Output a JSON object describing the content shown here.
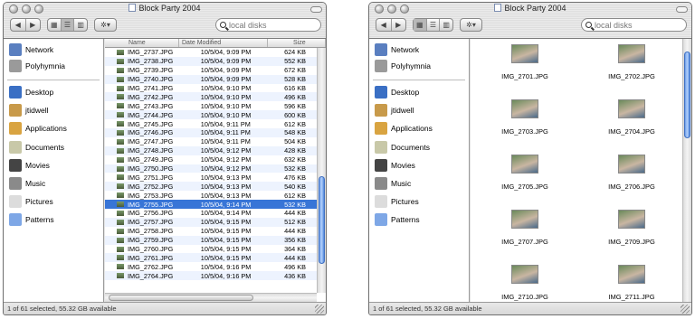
{
  "window_title": "Block Party 2004",
  "search_placeholder": "local disks",
  "toolbar": {
    "back": "◀",
    "forward": "▶",
    "icon_view": "▦",
    "list_view": "☰",
    "column_view": "▥",
    "action": "✲▾"
  },
  "sidebar": {
    "devices": [
      {
        "label": "Network",
        "icon": "network-icon",
        "color": "#5a7fc0"
      },
      {
        "label": "Polyhymnia",
        "icon": "hard-disk-icon",
        "color": "#9a9a9a"
      }
    ],
    "places": [
      {
        "label": "Desktop",
        "icon": "desktop-icon",
        "color": "#3a6fc4"
      },
      {
        "label": "jtidwell",
        "icon": "home-icon",
        "color": "#c89a4a"
      },
      {
        "label": "Applications",
        "icon": "applications-icon",
        "color": "#d9a441"
      },
      {
        "label": "Documents",
        "icon": "documents-icon",
        "color": "#c8c8a8"
      },
      {
        "label": "Movies",
        "icon": "movies-icon",
        "color": "#444444"
      },
      {
        "label": "Music",
        "icon": "music-icon",
        "color": "#8a8a8a"
      },
      {
        "label": "Pictures",
        "icon": "pictures-icon",
        "color": "#dcdcdc"
      },
      {
        "label": "Patterns",
        "icon": "folder-icon",
        "color": "#7ea7e6"
      }
    ]
  },
  "list_view": {
    "columns": [
      "Name",
      "Date Modified",
      "Size"
    ],
    "rows": [
      [
        "IMG_2737.JPG",
        "10/5/04, 9:09 PM",
        "624 KB"
      ],
      [
        "IMG_2738.JPG",
        "10/5/04, 9:09 PM",
        "552 KB"
      ],
      [
        "IMG_2739.JPG",
        "10/5/04, 9:09 PM",
        "672 KB"
      ],
      [
        "IMG_2740.JPG",
        "10/5/04, 9:09 PM",
        "528 KB"
      ],
      [
        "IMG_2741.JPG",
        "10/5/04, 9:10 PM",
        "616 KB"
      ],
      [
        "IMG_2742.JPG",
        "10/5/04, 9:10 PM",
        "496 KB"
      ],
      [
        "IMG_2743.JPG",
        "10/5/04, 9:10 PM",
        "596 KB"
      ],
      [
        "IMG_2744.JPG",
        "10/5/04, 9:10 PM",
        "600 KB"
      ],
      [
        "IMG_2745.JPG",
        "10/5/04, 9:11 PM",
        "612 KB"
      ],
      [
        "IMG_2746.JPG",
        "10/5/04, 9:11 PM",
        "548 KB"
      ],
      [
        "IMG_2747.JPG",
        "10/5/04, 9:11 PM",
        "504 KB"
      ],
      [
        "IMG_2748.JPG",
        "10/5/04, 9:12 PM",
        "428 KB"
      ],
      [
        "IMG_2749.JPG",
        "10/5/04, 9:12 PM",
        "632 KB"
      ],
      [
        "IMG_2750.JPG",
        "10/5/04, 9:12 PM",
        "532 KB"
      ],
      [
        "IMG_2751.JPG",
        "10/5/04, 9:13 PM",
        "476 KB"
      ],
      [
        "IMG_2752.JPG",
        "10/5/04, 9:13 PM",
        "540 KB"
      ],
      [
        "IMG_2753.JPG",
        "10/5/04, 9:13 PM",
        "612 KB"
      ],
      [
        "IMG_2755.JPG",
        "10/5/04, 9:14 PM",
        "532 KB"
      ],
      [
        "IMG_2756.JPG",
        "10/5/04, 9:14 PM",
        "444 KB"
      ],
      [
        "IMG_2757.JPG",
        "10/5/04, 9:15 PM",
        "512 KB"
      ],
      [
        "IMG_2758.JPG",
        "10/5/04, 9:15 PM",
        "444 KB"
      ],
      [
        "IMG_2759.JPG",
        "10/5/04, 9:15 PM",
        "356 KB"
      ],
      [
        "IMG_2760.JPG",
        "10/5/04, 9:15 PM",
        "364 KB"
      ],
      [
        "IMG_2761.JPG",
        "10/5/04, 9:15 PM",
        "444 KB"
      ],
      [
        "IMG_2762.JPG",
        "10/5/04, 9:16 PM",
        "496 KB"
      ],
      [
        "IMG_2764.JPG",
        "10/5/04, 9:16 PM",
        "436 KB"
      ]
    ],
    "selected_row": "IMG_2755.JPG"
  },
  "icon_view": {
    "items": [
      "IMG_2701.JPG",
      "IMG_2702.JPG",
      "IMG_2703.JPG",
      "IMG_2704.JPG",
      "IMG_2705.JPG",
      "IMG_2706.JPG",
      "IMG_2707.JPG",
      "IMG_2709.JPG",
      "IMG_2710.JPG",
      "IMG_2711.JPG"
    ]
  },
  "status_text": "1 of 61 selected, 55.32 GB available",
  "colors": {
    "selection": "#3875d7",
    "stripe": "#edf3fe"
  }
}
